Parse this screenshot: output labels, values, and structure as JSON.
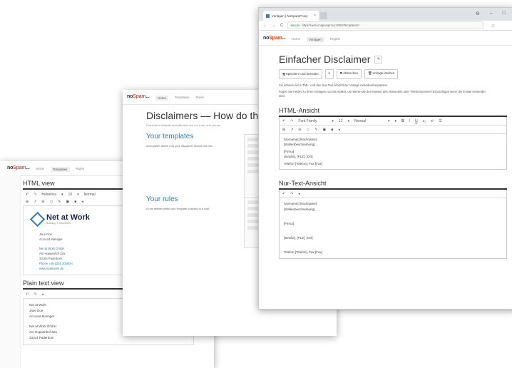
{
  "brand": {
    "prefix": "no",
    "highlight": "Spam",
    "suffix": "..."
  },
  "nav": [
    "Home",
    "Templates",
    "Rules"
  ],
  "win1": {
    "html_view": "HTML view",
    "toolbar": [
      "↶",
      "↷",
      "Helvetica",
      "▾",
      "10",
      "▾",
      "Normal"
    ],
    "toolbar2": [
      "⊞",
      "↗",
      "⊟",
      "▭",
      "✎",
      "▣",
      "■",
      "◂"
    ],
    "logo_title": "Net at Work",
    "logo_sub": "Building IT Excellence",
    "sig": {
      "name": "Jane Doe",
      "role": "Account Manager",
      "company": "Net at Work GmbH",
      "street": "Am Hoppenhof 32a",
      "city": "33104 Paderborn",
      "phone": "Phone +49 5251 30460H",
      "web": "www.netatwork.de"
    },
    "plain_view": "Plain text view",
    "plain_toolbar": [
      "↶",
      "↷",
      "◂"
    ],
    "plain_lines": [
      "Net at Work",
      "Jane Doe",
      "Account Manager",
      "Net at Work GmbH",
      "Am Hoppenhof 32a",
      "33104 Paderborn"
    ]
  },
  "win2": {
    "title": "Disclaimers — How do they w",
    "subtitle": "First build a template and after that use it in a rule and you are",
    "templates_h": "Your templates",
    "templates_desc": "A templates define how your disclaimer should look like",
    "rules_h": "Your rules",
    "rules_desc": "A rule defines when your template is added to a mail."
  },
  "win3": {
    "tab_title": "Vorlagen | NoSpamProxy",
    "tab_close": "×",
    "win_controls": [
      "⊖",
      "–",
      "□"
    ],
    "addr_icons": [
      "←",
      "→",
      "C"
    ],
    "secure": "Secure",
    "url": "https://web.nospamproxy:8000/Templates/1",
    "star": "☆",
    "nav_active": "Vorlagen",
    "nav": [
      "Home",
      "Vorlagen",
      "Regeln"
    ],
    "title": "Einfacher Disclaimer",
    "edit_icon": "✎",
    "buttons": [
      "🖫 Speichern und beenden",
      "▾",
      "✖ Abbrechen",
      "🗑 Vorlage löschen"
    ],
    "info1": "Sie können den HTML- und den Nur-Text-Inhalt Ihrer Vorlage individuell anpassen.",
    "info2": "Fügen Sie Felder zu Ihren Vorlagen, wo Sie wollen, um Werte wie den Namen des Absenders oder Telefonnummer hinzuzufügen wenn die E-Mail versendet wird.",
    "html_h": "HTML-Ansicht",
    "html_tb1": [
      "↶",
      "↷",
      "Font Family",
      "▾",
      "12",
      "▾",
      "Normal",
      "▾",
      "♦",
      "B",
      "I",
      "U",
      "x₂",
      "x²",
      "☰"
    ],
    "html_tb2": [
      "⊞",
      "↗",
      "⊟",
      "▭",
      "✎",
      "▣",
      "■",
      "◂"
    ],
    "html_lines": [
      "[Vorname] [Nachname]",
      "[Stellenbeschreibung]",
      "",
      "[Firma]",
      "[Straße], [PLZ], [Ort]",
      "",
      "Telefon [Telefon], Fax [Fax]"
    ],
    "plain_h": "Nur-Text-Ansicht",
    "plain_tb": [
      "↶",
      "↷",
      "◂"
    ],
    "plain_lines": [
      "[Vorname] [Nachname]",
      "[Stellenbeschreibung]",
      "",
      "[Firma]",
      "",
      "[Straße], [PLZ], [Ort]",
      "",
      "Telefon [Telefon], Fax [Fax]"
    ]
  }
}
